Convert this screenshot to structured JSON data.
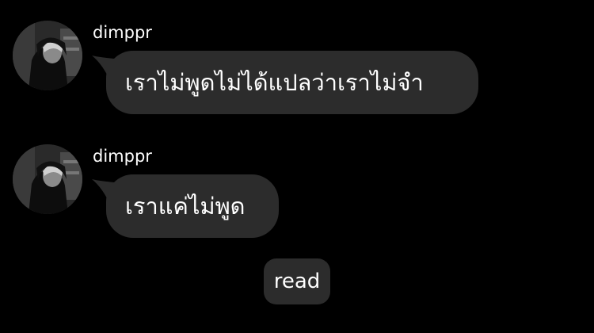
{
  "messages": [
    {
      "sender": "dimppr",
      "text": "เราไม่พูดไม่ได้แปลว่าเราไม่จำ"
    },
    {
      "sender": "dimppr",
      "text": "เราแค่ไม่พูด"
    }
  ],
  "status": {
    "read_label": "read"
  },
  "colors": {
    "background": "#000000",
    "bubble": "#2c2c2c",
    "text": "#ffffff"
  }
}
